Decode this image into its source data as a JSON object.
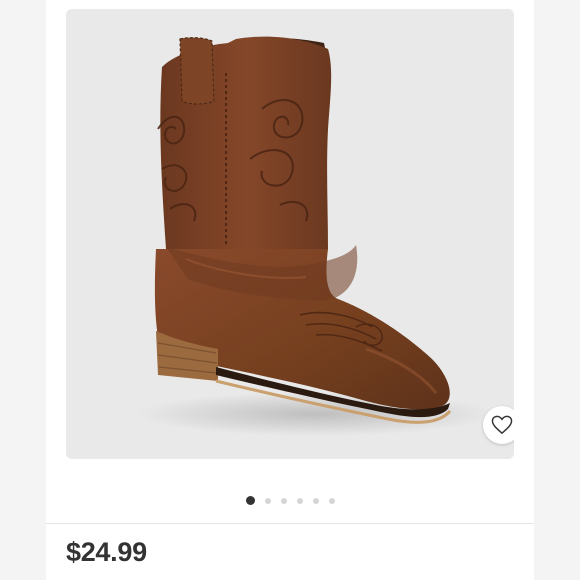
{
  "product": {
    "price": "$24.99",
    "image_subject": "brown-cowboy-boot"
  },
  "gallery": {
    "dot_count": 6,
    "active_index": 0
  },
  "icons": {
    "favorite": "heart-outline-icon"
  },
  "colors": {
    "page_bg": "#f4f4f4",
    "card_bg": "#ffffff",
    "image_bg": "#e9e9e9",
    "boot_brown": "#7a4026",
    "price_text": "#333333",
    "dot_active": "#333333",
    "dot_inactive": "#d6d6d6"
  }
}
